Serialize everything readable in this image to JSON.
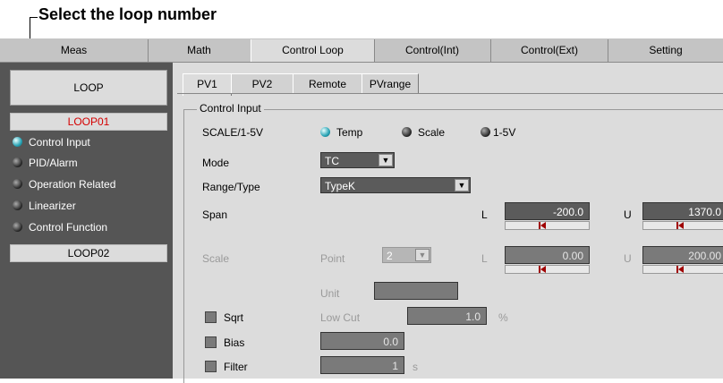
{
  "callout": "Select the loop number",
  "top_tabs": [
    "Meas",
    "Math",
    "Control Loop",
    "Control(Int)",
    "Control(Ext)",
    "Setting"
  ],
  "sidebar": {
    "header": "LOOP",
    "loop01": "LOOP01",
    "items": [
      "Control Input",
      "PID/Alarm",
      "Operation Related",
      "Linearizer",
      "Control Function"
    ],
    "loop02": "LOOP02"
  },
  "sub_tabs": [
    "PV1",
    "PV2",
    "Remote",
    "PVrange"
  ],
  "group_label": "Control Input",
  "scale_row": {
    "label": "SCALE/1-5V",
    "options": [
      "Temp",
      "Scale",
      "1-5V"
    ],
    "selected": "Temp"
  },
  "mode": {
    "label": "Mode",
    "value": "TC"
  },
  "range": {
    "label": "Range/Type",
    "value": "TypeK"
  },
  "span": {
    "label": "Span",
    "l_label": "L",
    "l_value": "-200.0",
    "u_label": "U",
    "u_value": "1370.0"
  },
  "scale": {
    "label": "Scale",
    "point_label": "Point",
    "point_value": "2",
    "l_label": "L",
    "l_value": "0.00",
    "u_label": "U",
    "u_value": "200.00"
  },
  "unit": {
    "label": "Unit",
    "value": ""
  },
  "sqrt": {
    "label": "Sqrt",
    "lowcut_label": "Low Cut",
    "lowcut_value": "1.0",
    "lowcut_unit": "%"
  },
  "bias": {
    "label": "Bias",
    "value": "0.0"
  },
  "filter": {
    "label": "Filter",
    "value": "1",
    "unit": "s"
  },
  "colors": {
    "led_on": "#27a2b4",
    "loop_selected_text": "#d40000",
    "field_bg": "#5b5b5b",
    "marker": "#a00000"
  }
}
